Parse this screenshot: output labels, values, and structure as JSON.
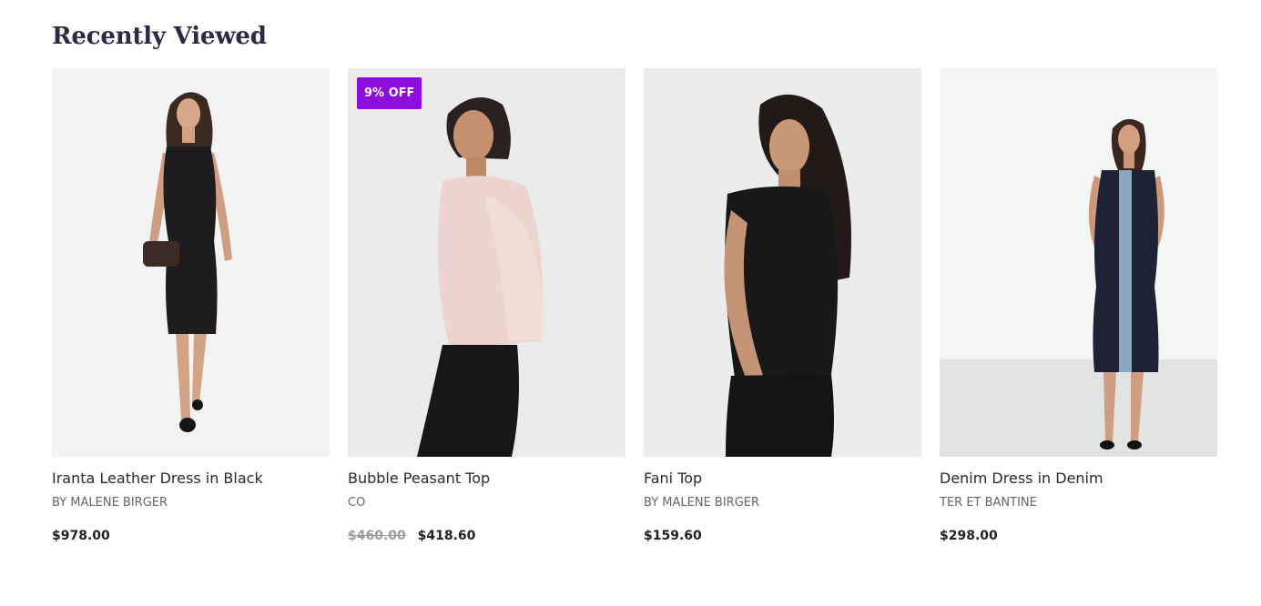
{
  "section": {
    "title": "Recently Viewed"
  },
  "products": [
    {
      "title": "Iranta Leather Dress in Black",
      "vendor": "BY MALENE BIRGER",
      "price": "$978.00",
      "compare_price": "",
      "badge": "",
      "image_name": "black-leather-dress-photo"
    },
    {
      "title": "Bubble Peasant Top",
      "vendor": "CO",
      "price": "$418.60",
      "compare_price": "$460.00",
      "badge": "9% OFF",
      "image_name": "pink-peasant-top-photo"
    },
    {
      "title": "Fani Top",
      "vendor": "BY MALENE BIRGER",
      "price": "$159.60",
      "compare_price": "",
      "badge": "",
      "image_name": "black-tee-photo"
    },
    {
      "title": "Denim Dress in Denim",
      "vendor": "TER ET BANTINE",
      "price": "$298.00",
      "compare_price": "",
      "badge": "",
      "image_name": "denim-dress-photo"
    }
  ],
  "colors": {
    "badge_bg": "#8d0ddc",
    "title": "#2b2b45",
    "compare_price": "#9a9a9a"
  }
}
